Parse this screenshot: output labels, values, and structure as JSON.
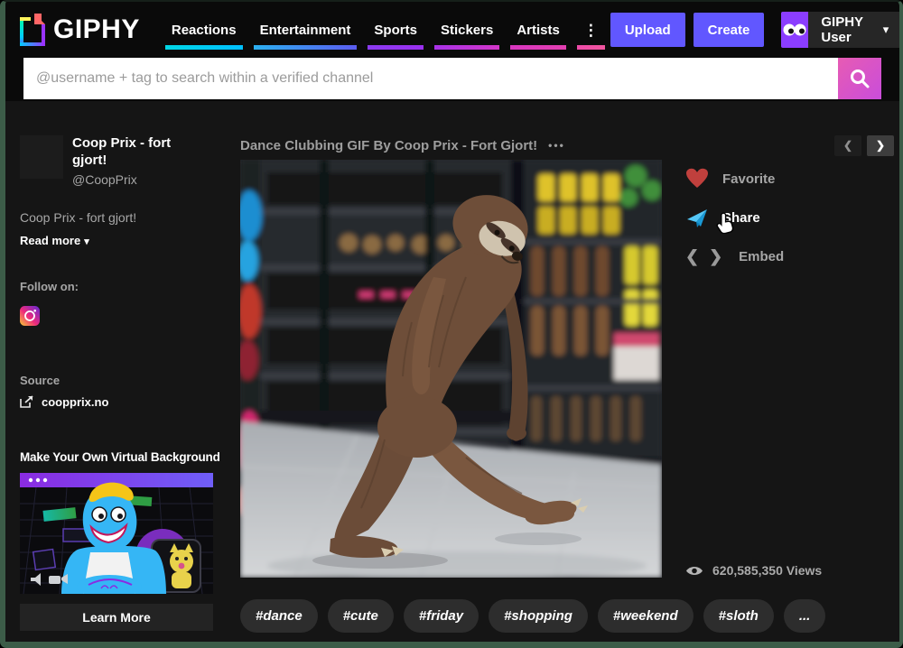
{
  "header": {
    "logo_text": "GIPHY",
    "nav": [
      {
        "label": "Reactions",
        "underline": [
          "#00d6e4",
          "#00bfff"
        ]
      },
      {
        "label": "Entertainment",
        "underline": [
          "#2bb0f0",
          "#5b5cf0"
        ]
      },
      {
        "label": "Sports",
        "underline": [
          "#8a3af0",
          "#9b30f0"
        ]
      },
      {
        "label": "Stickers",
        "underline": [
          "#a832e8",
          "#d336c8"
        ]
      },
      {
        "label": "Artists",
        "underline": [
          "#d836c0",
          "#e33fb0"
        ]
      },
      {
        "label": "⋮",
        "underline": [
          "#ee4aa8",
          "#f0559e"
        ]
      }
    ],
    "upload_label": "Upload",
    "create_label": "Create",
    "user_name": "GIPHY User"
  },
  "search": {
    "placeholder": "@username + tag to search within a verified channel"
  },
  "sidebar": {
    "channel_name": "Coop Prix - fort gjort!",
    "channel_handle": "@CoopPrix",
    "description": "Coop Prix - fort gjort!",
    "read_more_label": "Read more",
    "follow_label": "Follow on:",
    "source_label": "Source",
    "source_link": "coopprix.no",
    "ad_title": "Make Your Own Virtual Background",
    "learn_more_label": "Learn More"
  },
  "main": {
    "gif_title": "Dance Clubbing GIF By Coop Prix - Fort Gjort!"
  },
  "actions": {
    "favorite_label": "Favorite",
    "share_label": "Share",
    "embed_label": "Embed",
    "views_text": "620,585,350 Views"
  },
  "tags": [
    "#dance",
    "#cute",
    "#friday",
    "#shopping",
    "#weekend",
    "#sloth",
    "..."
  ],
  "icons": {
    "menu_ellipsis": "•••",
    "prev_arrow": "❮",
    "next_arrow": "❯",
    "embed_glyph": "❮ ❯",
    "caret_down": "▾",
    "read_more_caret": "▾"
  },
  "colors": {
    "accent_purple": "#6157ff",
    "user_avatar_purple": "#8b3dff",
    "search_gradient": [
      "#e75bb3",
      "#c94ddb"
    ],
    "favorite_red": "#c0403d",
    "share_blue": "#29b6f6",
    "header_background": "#0a0a0a",
    "page_background": "#151515",
    "frame_border_green": "#3c5c48"
  }
}
